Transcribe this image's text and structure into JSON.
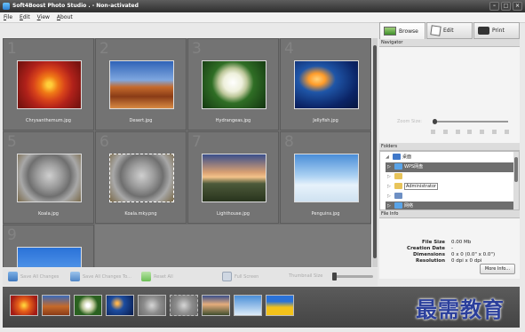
{
  "window": {
    "title": "Soft4Boost Photo Studio . - Non-activated",
    "controls": [
      "–",
      "□",
      "×"
    ]
  },
  "menu": [
    "File",
    "Edit",
    "View",
    "About"
  ],
  "tabs": [
    {
      "label": "Browse",
      "icon": "browse-icon",
      "active": true
    },
    {
      "label": "Edit",
      "icon": "edit-icon",
      "active": false
    },
    {
      "label": "Print",
      "icon": "printer-icon",
      "active": false
    }
  ],
  "grid": {
    "cells": [
      {
        "num": "1",
        "file": "Chrysanthemum.jpg",
        "selected": false
      },
      {
        "num": "2",
        "file": "Desert.jpg",
        "selected": false
      },
      {
        "num": "3",
        "file": "Hydrangeas.jpg",
        "selected": false
      },
      {
        "num": "4",
        "file": "Jellyfish.jpg",
        "selected": false
      },
      {
        "num": "5",
        "file": "Koala.jpg",
        "selected": false
      },
      {
        "num": "6",
        "file": "Koala.mky.png",
        "selected": true
      },
      {
        "num": "7",
        "file": "Lighthouse.jpg",
        "selected": false
      },
      {
        "num": "8",
        "file": "Penguins.jpg",
        "selected": false
      },
      {
        "num": "9",
        "file": "",
        "selected": false
      }
    ]
  },
  "toolbar": {
    "save": "Save All Changes",
    "save_to": "Save All Changes To...",
    "reset": "Reset All",
    "full_screen": "Full Screen",
    "thumb_size": "Thumbnail Size"
  },
  "navigator": {
    "title": "Navigator",
    "zoom_label": "Zoom Size:"
  },
  "folders": {
    "title": "Folders",
    "items": [
      {
        "label": "桌面",
        "indent": 0,
        "selected": false
      },
      {
        "label": "WPS网盘",
        "indent": 1,
        "selected": true
      },
      {
        "label": "",
        "indent": 1,
        "selected": false
      },
      {
        "label": "Administrator",
        "indent": 1,
        "selected": false
      },
      {
        "label": "",
        "indent": 1,
        "selected": false
      },
      {
        "label": "网络",
        "indent": 1,
        "selected": false
      }
    ]
  },
  "file_info": {
    "title": "File Info",
    "rows": [
      {
        "key": "File Size",
        "value": "0.00 Mb"
      },
      {
        "key": "Creation Date",
        "value": "-"
      },
      {
        "key": "Dimensions",
        "value": "0 x 0 (0.0\" x 0.0\")"
      },
      {
        "key": "Resolution",
        "value": "0 dpi x 0 dpi"
      }
    ],
    "more_button": "More Info..."
  },
  "watermark": "最需教育"
}
